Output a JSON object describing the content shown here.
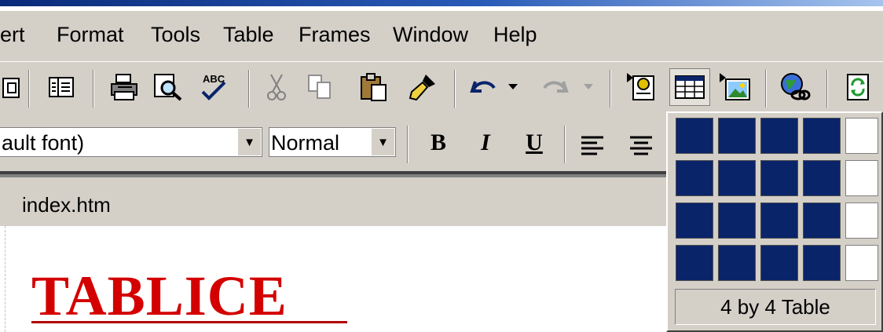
{
  "menu": {
    "items": [
      "ert",
      "Format",
      "Tools",
      "Table",
      "Frames",
      "Window",
      "Help"
    ]
  },
  "toolbar": {
    "icons": [
      "folder-list-icon",
      "navigation-icon",
      "print-icon",
      "print-preview-icon",
      "spelling-icon",
      "cut-icon",
      "copy-icon",
      "paste-icon",
      "format-painter-icon",
      "undo-icon",
      "undo-dropdown-icon",
      "redo-icon",
      "redo-dropdown-icon",
      "insert-component-icon",
      "insert-table-icon",
      "insert-picture-icon",
      "hyperlink-icon",
      "refresh-icon"
    ]
  },
  "format_bar": {
    "font_value": "ault font)",
    "style_value": "Normal",
    "bold_label": "B",
    "italic_label": "I",
    "underline_label": "U"
  },
  "tab": {
    "label": "index.htm"
  },
  "document": {
    "heading": "TABLICE"
  },
  "table_picker": {
    "rows_selected": 4,
    "cols_selected": 4,
    "status": "4 by 4 Table"
  },
  "colors": {
    "title_bar": "#0a2a7a",
    "chrome": "#d4d0c8",
    "selection": "#0a246a",
    "heading": "#d40000"
  }
}
